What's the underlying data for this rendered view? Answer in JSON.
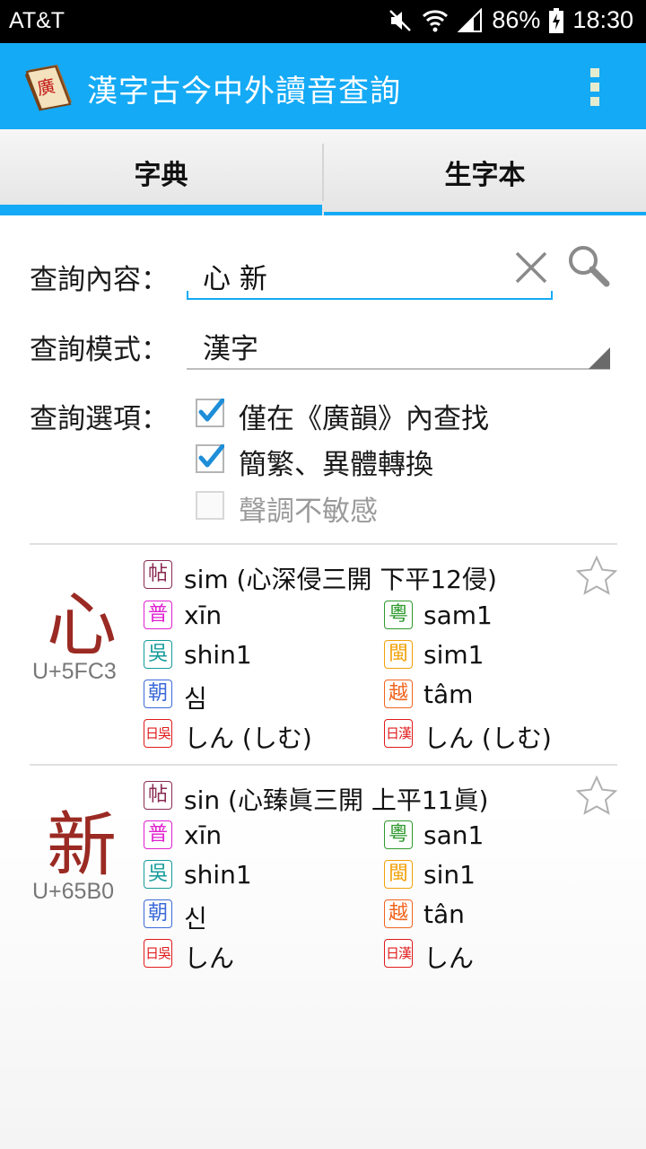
{
  "status_bar": {
    "carrier": "AT&T",
    "battery": "86%",
    "time": "18:30"
  },
  "app": {
    "title": "漢字古今中外讀音查詢",
    "logo_text": "廣"
  },
  "tabs": [
    {
      "label": "字典",
      "active": true
    },
    {
      "label": "生字本",
      "active": false
    }
  ],
  "form": {
    "search_label": "查詢內容：",
    "search_value": "心 新",
    "mode_label": "查詢模式：",
    "mode_value": "漢字",
    "options_label": "查詢選項：",
    "options": [
      {
        "label": "僅在《廣韻》內查找",
        "checked": true,
        "enabled": true
      },
      {
        "label": "簡繁、異體轉換",
        "checked": true,
        "enabled": true
      },
      {
        "label": "聲調不敏感",
        "checked": false,
        "enabled": false
      }
    ]
  },
  "badges": {
    "guangyun": "帖",
    "mandarin": "普",
    "cantonese": "粵",
    "wu": "吳",
    "min": "閩",
    "korean": "朝",
    "vietnamese": "越",
    "jp_go": "日吳",
    "jp_kan": "日漢"
  },
  "colors": {
    "accent": "#14aaf5",
    "char": "#9a2a23",
    "guangyun": "#8a2a52",
    "mandarin": "#e01ed0",
    "cantonese": "#2e9a2e",
    "wu": "#159a9a",
    "min": "#f2a20a",
    "korean": "#3a6ad8",
    "vietnamese": "#f0641e",
    "japanese": "#e01a1a"
  },
  "entries": [
    {
      "char": "心",
      "codepoint": "U+5FC3",
      "guangyun": "sim (心深侵三開 下平12侵)",
      "mandarin": "xīn",
      "cantonese": "sam1",
      "wu": "shin1",
      "min": "sim1",
      "korean": "심",
      "vietnamese": "tâm",
      "jp_go": "しん (しむ)",
      "jp_kan": "しん (しむ)",
      "starred": false
    },
    {
      "char": "新",
      "codepoint": "U+65B0",
      "guangyun": "sin (心臻眞三開 上平11眞)",
      "mandarin": "xīn",
      "cantonese": "san1",
      "wu": "shin1",
      "min": "sin1",
      "korean": "신",
      "vietnamese": "tân",
      "jp_go": "しん",
      "jp_kan": "しん",
      "starred": false
    }
  ]
}
